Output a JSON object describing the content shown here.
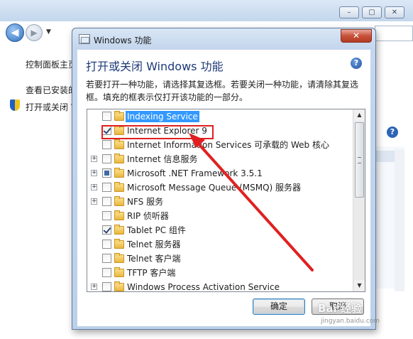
{
  "background_window": {
    "caption_buttons": [
      "–",
      "▢",
      "✕"
    ],
    "left_links": [
      "控制面板主页",
      "查看已安装的更新",
      "打开或关闭 Windows 功能"
    ]
  },
  "dialog": {
    "title": "Windows 功能",
    "heading": "打开或关闭 Windows 功能",
    "description": "若要打开一种功能，请选择其复选框。若要关闭一种功能，请清除其复选框。填充的框表示仅打开该功能的一部分。",
    "features": [
      {
        "label": "Indexing Service",
        "expandable": false,
        "state": "unchecked",
        "selected": true
      },
      {
        "label": "Internet Explorer 9",
        "expandable": false,
        "state": "checked",
        "selected": false
      },
      {
        "label": "Internet Information Services 可承载的 Web 核心",
        "expandable": false,
        "state": "unchecked",
        "selected": false
      },
      {
        "label": "Internet 信息服务",
        "expandable": true,
        "state": "unchecked",
        "selected": false
      },
      {
        "label": "Microsoft .NET Framework 3.5.1",
        "expandable": true,
        "state": "partial",
        "selected": false
      },
      {
        "label": "Microsoft Message Queue (MSMQ) 服务器",
        "expandable": true,
        "state": "unchecked",
        "selected": false
      },
      {
        "label": "NFS 服务",
        "expandable": true,
        "state": "unchecked",
        "selected": false
      },
      {
        "label": "RIP 侦听器",
        "expandable": false,
        "state": "unchecked",
        "selected": false
      },
      {
        "label": "Tablet PC 组件",
        "expandable": false,
        "state": "checked",
        "selected": false
      },
      {
        "label": "Telnet 服务器",
        "expandable": false,
        "state": "unchecked",
        "selected": false
      },
      {
        "label": "Telnet 客户端",
        "expandable": false,
        "state": "unchecked",
        "selected": false
      },
      {
        "label": "TFTP 客户端",
        "expandable": false,
        "state": "unchecked",
        "selected": false
      },
      {
        "label": "Windows Process Activation Service",
        "expandable": true,
        "state": "unchecked",
        "selected": false
      }
    ],
    "ok_label": "确定",
    "cancel_label": "取消",
    "close_glyph": "✕",
    "help_glyph": "?"
  },
  "annotation": {
    "color": "#e02020"
  },
  "watermark": {
    "text": "Bai 经验",
    "sub": "jingyan.baidu.com"
  }
}
